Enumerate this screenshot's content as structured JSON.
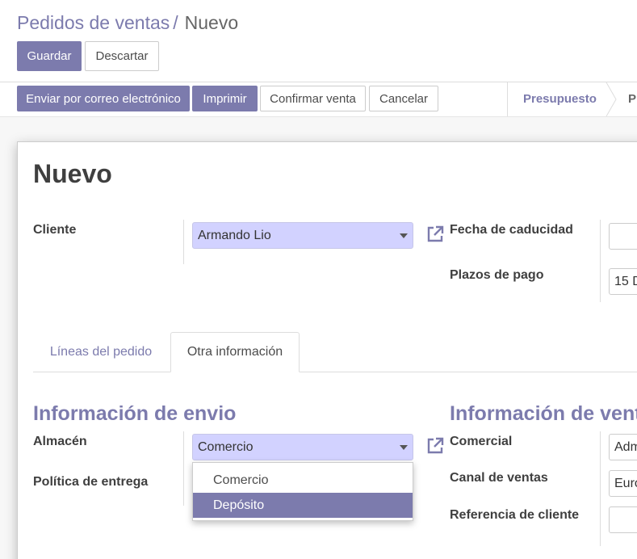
{
  "breadcrumb": {
    "parent": "Pedidos de ventas",
    "separator": "/",
    "current": "Nuevo"
  },
  "form_buttons": {
    "save": "Guardar",
    "discard": "Descartar"
  },
  "header_buttons": {
    "send_email": "Enviar por correo electrónico",
    "print": "Imprimir",
    "confirm": "Confirmar venta",
    "cancel": "Cancelar"
  },
  "statusbar": {
    "stage_1": "Presupuesto",
    "stage_2_partial": "P"
  },
  "record": {
    "title": "Nuevo",
    "customer_label": "Cliente",
    "customer_value": "Armando Lio",
    "expiration_label": "Fecha de caducidad",
    "expiration_value": "",
    "payment_terms_label": "Plazos de pago",
    "payment_terms_value": "15 D"
  },
  "tabs": {
    "order_lines": "Líneas del pedido",
    "other_info": "Otra información"
  },
  "shipping": {
    "title": "Información de envio",
    "warehouse_label": "Almacén",
    "warehouse_value": "Comercio",
    "delivery_policy_label": "Política de entrega"
  },
  "sales": {
    "title": "Información de vent",
    "salesperson_label": "Comercial",
    "salesperson_value": "Adm",
    "sales_channel_label": "Canal de ventas",
    "sales_channel_value": "Euro",
    "customer_ref_label": "Referencia de cliente",
    "customer_ref_value": ""
  },
  "warehouse_dropdown": {
    "options": [
      "Comercio",
      "Depósito"
    ],
    "highlighted_index": 1
  },
  "colors": {
    "brand": "#7c7bad",
    "many2one_bg": "#d2d2ff"
  },
  "icons": {
    "external_link": "external-link-icon",
    "dropdown": "caret-down-icon"
  }
}
